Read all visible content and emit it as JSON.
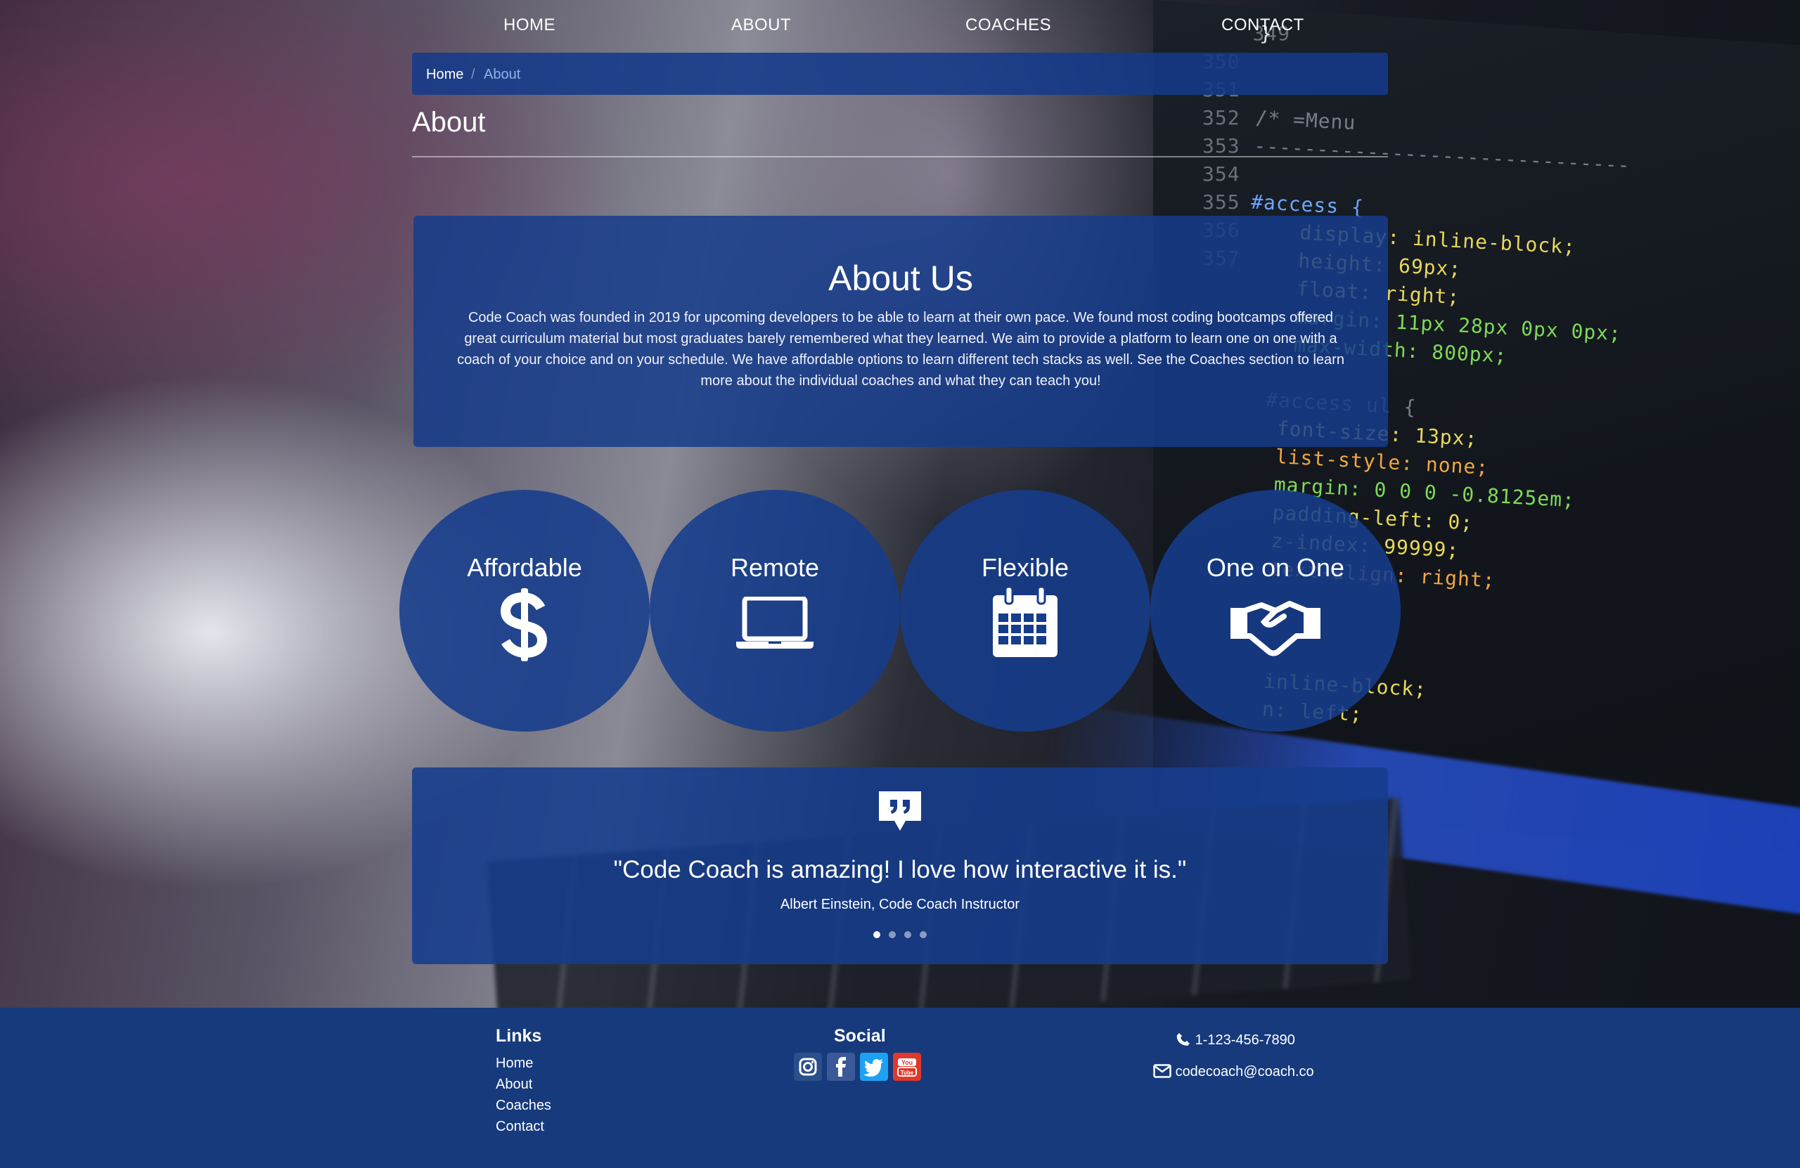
{
  "nav": {
    "items": [
      "HOME",
      "ABOUT",
      "COACHES",
      "CONTACT"
    ]
  },
  "breadcrumb": {
    "home": "Home",
    "separator": "/",
    "current": "About"
  },
  "page": {
    "title": "About"
  },
  "about": {
    "heading": "About Us",
    "text": "Code Coach was founded in 2019 for upcoming developers to be able to learn at their own pace. We found most coding bootcamps offered great curriculum material but most graduates barely remembered what they learned. We aim to provide a platform to learn one on one with a coach of your choice and on your schedule. We have affordable options to learn different tech stacks as well. See the Coaches section to learn more about the individual coaches and what they can teach you!"
  },
  "features": [
    {
      "label": "Affordable",
      "icon": "dollar-icon"
    },
    {
      "label": "Remote",
      "icon": "laptop-icon"
    },
    {
      "label": "Flexible",
      "icon": "calendar-icon"
    },
    {
      "label": "One on One",
      "icon": "handshake-icon"
    }
  ],
  "testimonial": {
    "icon": "quote-icon",
    "quote": "\"Code Coach is amazing! I love how interactive it is.\"",
    "author": "Albert Einstein, Code Coach Instructor",
    "slides": 4,
    "active_slide": 0
  },
  "footer": {
    "links_heading": "Links",
    "links": [
      "Home",
      "About",
      "Coaches",
      "Contact"
    ],
    "social_heading": "Social",
    "social": [
      {
        "icon": "instagram-icon",
        "color": "#2a4f8a"
      },
      {
        "icon": "facebook-icon",
        "color": "#3b5998"
      },
      {
        "icon": "twitter-icon",
        "color": "#1da1f2"
      },
      {
        "icon": "youtube-icon",
        "color": "#e0382b"
      }
    ],
    "phone": "1-123-456-7890",
    "email": "codecoach@coach.co"
  },
  "colors": {
    "panel": "#163c8c",
    "footer": "#163a7c",
    "breadcrumb_active": "#8fb4e8"
  },
  "background_code": {
    "line_numbers": [
      "349",
      "350",
      "351",
      "352",
      "353",
      "354",
      "355",
      "356",
      "357"
    ],
    "lines": [
      "}",
      "",
      "",
      "/* =Menu",
      "------------------------------",
      "",
      "#access {",
      "display: inline-block;",
      "height: 69px;",
      "float: right;",
      "margin: 11px 28px 0px 0px;",
      "max-width: 800px;",
      "#access ul {",
      "font-size: 13px;",
      "list-style: none;",
      "margin: 0 0 0 -0.8125em;",
      "padding-left: 0;",
      "z-index: 99999;",
      "text-align: right;",
      "inline-block;",
      "n: left;"
    ]
  }
}
